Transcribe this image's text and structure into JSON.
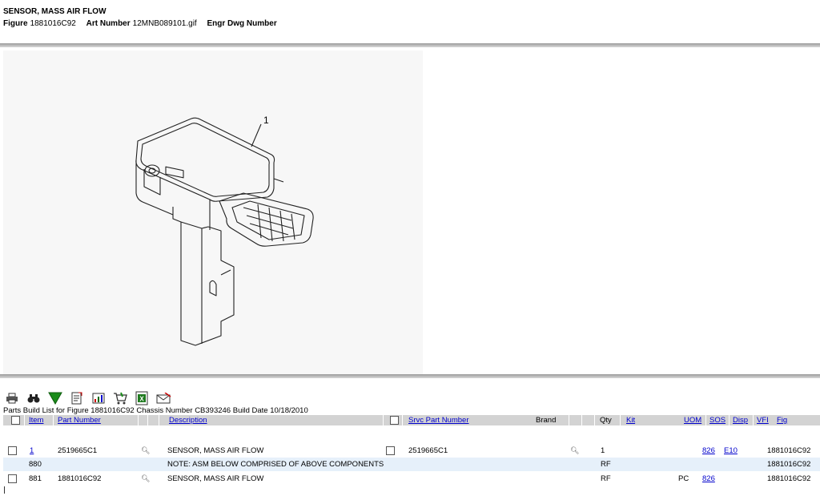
{
  "header": {
    "title": "SENSOR, MASS AIR FLOW",
    "figure_label": "Figure",
    "figure_value": "1881016C92",
    "art_label": "Art Number",
    "art_value": "12MNB089101.gif",
    "engr_label": "Engr Dwg Number"
  },
  "illustration": {
    "callout": "1"
  },
  "toolbar": {
    "icons": [
      "printer-icon",
      "binoculars-icon",
      "filter-icon",
      "document-add-icon",
      "chart-icon",
      "cart-icon",
      "excel-export-icon",
      "email-icon"
    ]
  },
  "build_caption": "Parts Build List for Figure 1881016C92 Chassis Number CB393246 Build Date 10/18/2010",
  "columns": {
    "item": "Item",
    "part_number": "Part Number",
    "description": "Description",
    "svc_part_number": "Srvc Part Number",
    "brand": "Brand",
    "qty": "Qty",
    "kit": "Kit",
    "uom": "UOM",
    "sos": "SOS",
    "disp": "Disp",
    "vfi": "VFI",
    "fig": "Fig"
  },
  "rows": [
    {
      "item": "1",
      "part_number": "2519665C1",
      "description": "SENSOR, MASS AIR FLOW",
      "svc_part_number": "2519665C1",
      "qty": "1",
      "uom": "",
      "sos": "826",
      "disp": "E10",
      "fig": "1881016C92"
    },
    {
      "item": "880",
      "part_number": "",
      "description": "NOTE: ASM BELOW COMPRISED OF ABOVE COMPONENTS",
      "qty": "RF",
      "fig": "1881016C92"
    },
    {
      "item": "881",
      "part_number": "1881016C92",
      "description": "SENSOR, MASS AIR FLOW",
      "qty": "RF",
      "uom": "PC",
      "sos": "826",
      "fig": "1881016C92"
    }
  ],
  "colors": {
    "link": "#0000cc",
    "grid_header": "#d3d3d3",
    "note_row": "#e6f0fa"
  }
}
